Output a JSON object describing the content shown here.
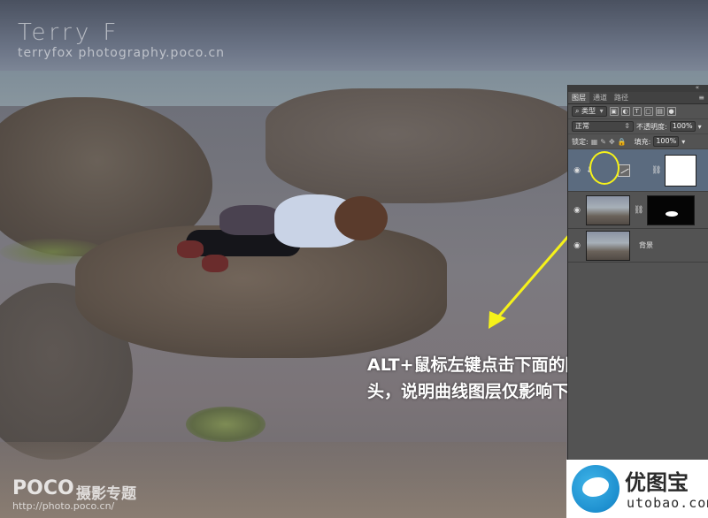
{
  "watermark": {
    "title": "Terry F",
    "subtitle": "terryfox photography.poco.cn",
    "poco_brand": "POCO",
    "poco_section": "摄影专题",
    "poco_url": "http://photo.poco.cn/"
  },
  "annotation": {
    "text": "ALT+鼠标左键点击下面的图层，出现该箭头，说明曲线图层仅影响下一图层",
    "arrow_color": "#f6f21a"
  },
  "layers_panel": {
    "tabs": [
      {
        "label": "图层",
        "active": true
      },
      {
        "label": "通道",
        "active": false
      },
      {
        "label": "路径",
        "active": false
      }
    ],
    "filter_kind": "类型",
    "blend_mode": "正常",
    "opacity_label": "不透明度:",
    "opacity_value": "100%",
    "lock_label": "锁定:",
    "fill_label": "填充:",
    "fill_value": "100%",
    "layers": [
      {
        "name": "",
        "type": "curves-adjustment",
        "selected": true,
        "clipped": true,
        "mask": "white"
      },
      {
        "name": "",
        "type": "pixel-with-mask",
        "selected": false,
        "clipped": false,
        "mask": "black-with-spot"
      },
      {
        "name": "背景",
        "type": "background",
        "selected": false,
        "clipped": false,
        "mask": null
      }
    ]
  },
  "logo": {
    "name_cn": "优图宝",
    "domain": "utobao.com",
    "brand_color": "#1d8fcf"
  }
}
